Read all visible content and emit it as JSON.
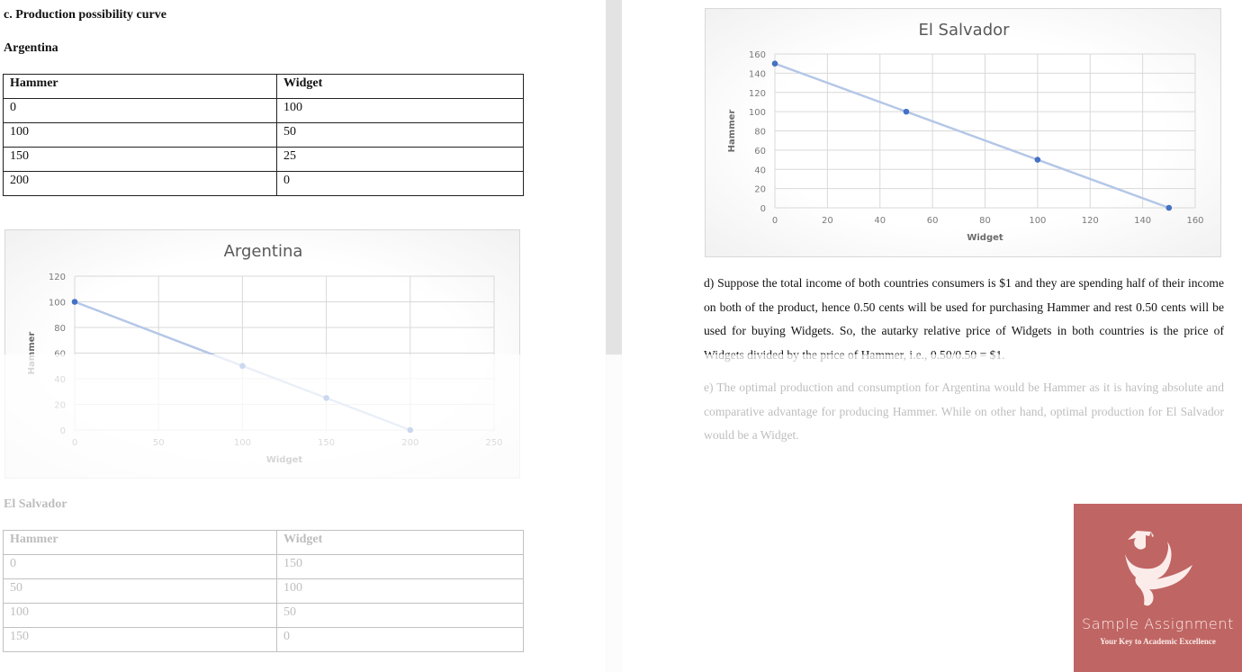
{
  "left_pane": {
    "section_heading": "c. Production possibility curve",
    "argentina": {
      "heading": "Argentina",
      "table": {
        "headers": [
          "Hammer",
          "Widget"
        ],
        "rows": [
          [
            "0",
            "100"
          ],
          [
            "100",
            "50"
          ],
          [
            "150",
            "25"
          ],
          [
            "200",
            "0"
          ]
        ]
      }
    },
    "el_salvador": {
      "heading": "El Salvador",
      "table": {
        "headers": [
          "Hammer",
          "Widget"
        ],
        "rows": [
          [
            "0",
            "150"
          ],
          [
            "50",
            "100"
          ],
          [
            "100",
            "50"
          ],
          [
            "150",
            "0"
          ]
        ]
      }
    }
  },
  "right_pane": {
    "paragraph_d": "d) Suppose the total income of both countries consumers is $1 and they are spending half of their income on both of the product, hence 0.50 cents will be used for purchasing Hammer and rest 0.50 cents will be used for buying Widgets. So, the autarky relative price of Widgets in both countries is the price of Widgets divided by the price of Hammer, i.e., 0.50/0.50 = $1.",
    "paragraph_e": "e) The optimal production and consumption for Argentina would be Hammer as it is having absolute and comparative advantage for producing Hammer. While on other hand, optimal production for El Salvador would be a Widget."
  },
  "logo": {
    "name": "Sample Assignment",
    "tagline": "Your Key to Academic Excellence",
    "icon": "graduate-figure-icon",
    "background_color": "#bf6563"
  },
  "colors": {
    "series": "#4472c4",
    "series_line": "#b4c7e7",
    "grid": "#d9d9d9"
  },
  "chart_data": [
    {
      "id": "argentina",
      "type": "scatter",
      "title": "Argentina",
      "xlabel": "Widget",
      "ylabel": "Hammer",
      "x": [
        0,
        100,
        150,
        200
      ],
      "y": [
        100,
        50,
        25,
        0
      ],
      "xlim": [
        0,
        250
      ],
      "ylim": [
        0,
        120
      ],
      "xticks": [
        0,
        50,
        100,
        150,
        200,
        250
      ],
      "yticks": [
        0,
        20,
        40,
        60,
        80,
        100,
        120
      ],
      "grid": true,
      "connected": true
    },
    {
      "id": "el_salvador",
      "type": "scatter",
      "title": "El Salvador",
      "xlabel": "Widget",
      "ylabel": "Hammer",
      "x": [
        0,
        50,
        100,
        150
      ],
      "y": [
        150,
        100,
        50,
        0
      ],
      "xlim": [
        0,
        160
      ],
      "ylim": [
        0,
        160
      ],
      "xticks": [
        0,
        20,
        40,
        60,
        80,
        100,
        120,
        140,
        160
      ],
      "yticks": [
        0,
        20,
        40,
        60,
        80,
        100,
        120,
        140,
        160
      ],
      "grid": true,
      "connected": true
    }
  ]
}
